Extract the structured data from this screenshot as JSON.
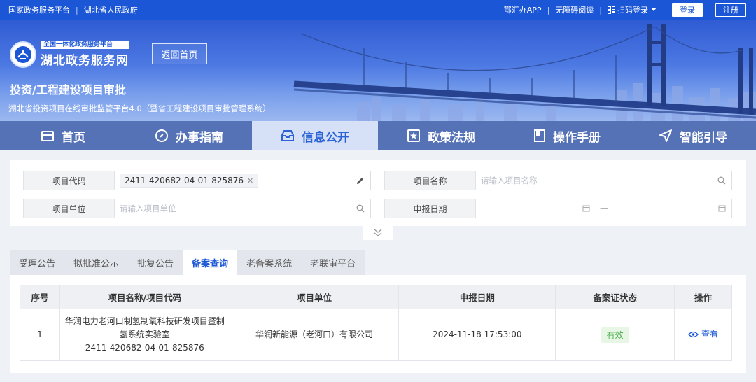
{
  "topbar": {
    "link_national": "国家政务服务平台",
    "link_province": "湖北省人民政府",
    "link_app": "鄂汇办APP",
    "link_accessible": "无障碍阅读",
    "link_scan": "扫码登录",
    "login": "登录",
    "register": "注册"
  },
  "banner": {
    "logo_small": "全国一体化政务服务平台",
    "logo_big": "湖北政务服务网",
    "back_home": "返回首页",
    "title": "投资/工程建设项目审批",
    "subtitle": "湖北省投资项目在线审批监管平台4.0（暨省工程建设项目审批管理系统）"
  },
  "nav": [
    {
      "label": "首页",
      "icon": "home-icon"
    },
    {
      "label": "办事指南",
      "icon": "compass-icon"
    },
    {
      "label": "信息公开",
      "icon": "inbox-icon",
      "active": true
    },
    {
      "label": "政策法规",
      "icon": "star-doc-icon"
    },
    {
      "label": "操作手册",
      "icon": "book-icon"
    },
    {
      "label": "智能引导",
      "icon": "navigation-icon"
    }
  ],
  "filters": {
    "project_code_label": "项目代码",
    "project_code_value": "2411-420682-04-01-825876",
    "project_name_label": "项目名称",
    "project_name_placeholder": "请输入项目名称",
    "project_unit_label": "项目单位",
    "project_unit_placeholder": "请输入项目单位",
    "report_date_label": "申报日期",
    "date_sep": "—"
  },
  "tabs": [
    "受理公告",
    "拟批准公示",
    "批复公告",
    "备案查询",
    "老备案系统",
    "老联审平台"
  ],
  "active_tab": "备案查询",
  "table": {
    "headers": [
      "序号",
      "项目名称/项目代码",
      "项目单位",
      "申报日期",
      "备案证状态",
      "操作"
    ],
    "rows": [
      {
        "index": "1",
        "name_line1": "华润电力老河口制氢制氧科技研发项目暨制",
        "name_line2": "氢系统实验室",
        "code": "2411-420682-04-01-825876",
        "unit": "华润新能源（老河口）有限公司",
        "date": "2024-11-18 17:53:00",
        "status": "有效",
        "action": "查看"
      }
    ]
  },
  "colors": {
    "primary": "#1b56d6",
    "status_green": "#4cae4c"
  }
}
